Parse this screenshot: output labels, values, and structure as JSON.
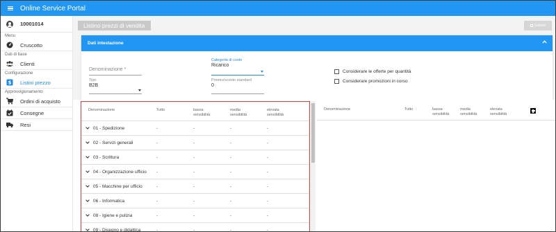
{
  "app": {
    "title": "Online Service Portal"
  },
  "sidebar": {
    "user_id": "10001014",
    "sections": [
      {
        "label": "Menu",
        "items": [
          {
            "label": "Cruscotto",
            "icon": "speedometer-icon",
            "active": false
          }
        ]
      },
      {
        "label": "Dati di base",
        "items": [
          {
            "label": "Clienti",
            "icon": "users-icon",
            "active": false
          }
        ]
      },
      {
        "label": "Configurazione",
        "items": [
          {
            "label": "Listini prezzo",
            "icon": "dollar-icon",
            "active": true
          }
        ]
      },
      {
        "label": "Approvvigionamento",
        "items": [
          {
            "label": "Ordini di acquisto",
            "icon": "cart-icon",
            "active": false
          },
          {
            "label": "Consegne",
            "icon": "calendar-check-icon",
            "active": false
          },
          {
            "label": "Resi",
            "icon": "truck-icon",
            "active": false
          }
        ]
      }
    ]
  },
  "page": {
    "title": "Listino prezzi di vendita",
    "save_label": "Salvare"
  },
  "header_card": {
    "title": "Dati intestazione",
    "denominazione_label": "Denominazione *",
    "categoria_label": "Categoria di costo",
    "categoria_value": "Ricarico",
    "tipo_label": "Tipo",
    "tipo_value": "B2B",
    "premio_label": "Premio/sconto standard",
    "premio_value": "0",
    "chk_offerte": "Considerare le offerte per quantità",
    "chk_promozioni": "Considerare promozioni in corso"
  },
  "left_table": {
    "headers": {
      "name": "Denominazione",
      "tutto": "Tutto",
      "bassa": "bassa sensibilità",
      "media": "media sensibilità",
      "elevata": "elevata sensibilità"
    },
    "rows": [
      {
        "name": "01 - Spedizione",
        "tutto": "-",
        "bassa": "-",
        "media": "-",
        "elevata": "-"
      },
      {
        "name": "02 - Servizi generali",
        "tutto": "-",
        "bassa": "-",
        "media": "-",
        "elevata": "-"
      },
      {
        "name": "03 - Scrittura",
        "tutto": "-",
        "bassa": "-",
        "media": "-",
        "elevata": "-"
      },
      {
        "name": "04 - Organizzazione ufficio",
        "tutto": "-",
        "bassa": "-",
        "media": "-",
        "elevata": "-"
      },
      {
        "name": "05 - Macchine per ufficio",
        "tutto": "-",
        "bassa": "-",
        "media": "-",
        "elevata": "-"
      },
      {
        "name": "06 - Informatica",
        "tutto": "-",
        "bassa": "-",
        "media": "-",
        "elevata": "-"
      },
      {
        "name": "08 - Igiene e pulizia",
        "tutto": "-",
        "bassa": "-",
        "media": "-",
        "elevata": "-"
      },
      {
        "name": "09 - Disegno e didattica",
        "tutto": "-",
        "bassa": "-",
        "media": "-",
        "elevata": "-"
      }
    ]
  },
  "right_table": {
    "headers": {
      "name": "Denominazione",
      "tutto": "Tutto",
      "bassa": "bassa sensibilità",
      "media": "media sensibilità",
      "elevata": "elevata sensibilità"
    }
  },
  "colors": {
    "primary": "#2196f3",
    "highlight_border": "#e23b3b",
    "active_nav": "#1e88e5"
  }
}
